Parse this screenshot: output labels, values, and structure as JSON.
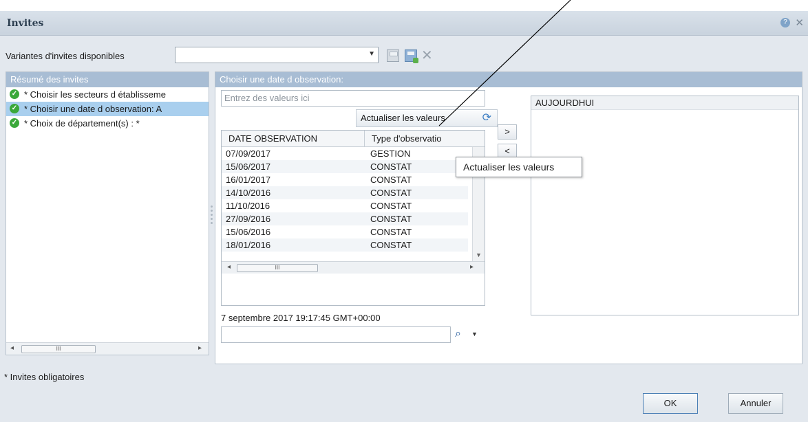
{
  "dialog": {
    "title": "Invites",
    "help_icon": "help-icon",
    "close_icon": "close-icon"
  },
  "variants": {
    "label": "Variantes d'invites disponibles",
    "value": "",
    "icons": [
      "save-icon",
      "save-as-icon",
      "delete-icon"
    ]
  },
  "summary": {
    "header": "Résumé des invites",
    "items": [
      {
        "label": "* Choisir les secteurs d établisseme",
        "status": "check-icon",
        "selected": false
      },
      {
        "label": "* Choisir une date d observation: A",
        "status": "check-icon",
        "selected": true
      },
      {
        "label": "* Choix de département(s) :  *",
        "status": "check-icon",
        "selected": false
      }
    ]
  },
  "prompt": {
    "header": "Choisir une date d observation:",
    "input_placeholder": "Entrez des valeurs ici",
    "refresh_label": "Actualiser les valeurs",
    "add_button": ">",
    "remove_button": "<",
    "columns": [
      "DATE OBSERVATION",
      "Type d'observatio"
    ],
    "rows": [
      [
        "07/09/2017",
        "GESTION"
      ],
      [
        "15/06/2017",
        "CONSTAT"
      ],
      [
        "16/01/2017",
        "CONSTAT"
      ],
      [
        "14/10/2016",
        "CONSTAT"
      ],
      [
        "11/10/2016",
        "CONSTAT"
      ],
      [
        "27/09/2016",
        "CONSTAT"
      ],
      [
        "15/06/2016",
        "CONSTAT"
      ],
      [
        "18/01/2016",
        "CONSTAT"
      ]
    ],
    "timestamp": "7 septembre 2017 19:17:45 GMT+00:00",
    "search_value": "",
    "selected_values": [
      "AUJOURDHUI"
    ],
    "tooltip": "Actualiser les valeurs"
  },
  "scrollbar_thumb": "III",
  "footer": {
    "note": "* Invites obligatoires",
    "ok_label": "OK",
    "cancel_label": "Annuler"
  },
  "colors": {
    "panel_header": "#a8bdd4",
    "selected_row": "#a9cfee",
    "check": "#3aa83a"
  }
}
